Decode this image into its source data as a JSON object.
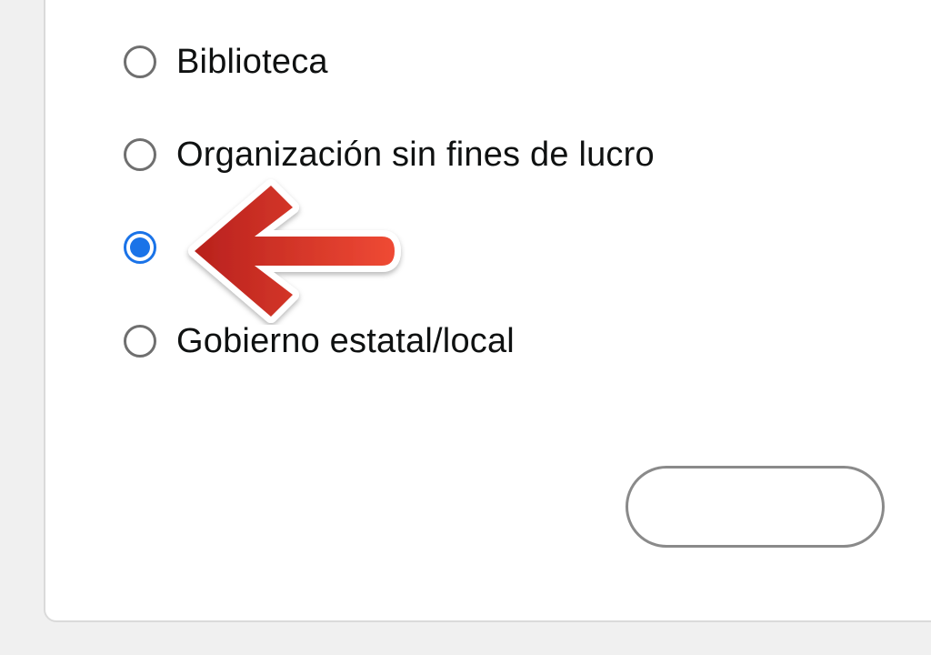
{
  "organization_type": {
    "options": [
      {
        "label": "Biblioteca",
        "selected": false
      },
      {
        "label": "Organización sin fines de lucro",
        "selected": false
      },
      {
        "label": "",
        "selected": true
      },
      {
        "label": "Gobierno estatal/local",
        "selected": false
      }
    ]
  },
  "annotation": {
    "icon": "red-arrow-left-icon",
    "color": "#e0332a"
  },
  "footer": {
    "continue_label": ""
  },
  "colors": {
    "accent": "#1a73e8",
    "border": "#6f6f6f"
  }
}
